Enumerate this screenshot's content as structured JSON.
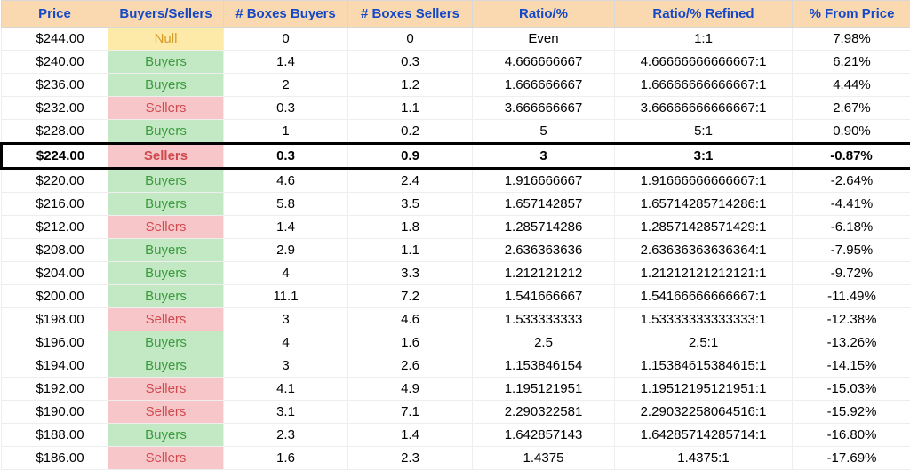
{
  "headers": {
    "price": "Price",
    "buyers_sellers": "Buyers/Sellers",
    "boxes_buyers": "# Boxes Buyers",
    "boxes_sellers": "# Boxes Sellers",
    "ratio": "Ratio/%",
    "ratio_refined": "Ratio/% Refined",
    "from_price": "% From Price"
  },
  "status_classes": {
    "Null": "null-cell",
    "Buyers": "buyers-cell",
    "Sellers": "sellers-cell"
  },
  "rows": [
    {
      "price": "$244.00",
      "bs": "Null",
      "bb": "0",
      "sb": "0",
      "ratio": "Even",
      "refined": "1:1",
      "from": "7.98%",
      "highlight": false
    },
    {
      "price": "$240.00",
      "bs": "Buyers",
      "bb": "1.4",
      "sb": "0.3",
      "ratio": "4.666666667",
      "refined": "4.66666666666667:1",
      "from": "6.21%",
      "highlight": false
    },
    {
      "price": "$236.00",
      "bs": "Buyers",
      "bb": "2",
      "sb": "1.2",
      "ratio": "1.666666667",
      "refined": "1.66666666666667:1",
      "from": "4.44%",
      "highlight": false
    },
    {
      "price": "$232.00",
      "bs": "Sellers",
      "bb": "0.3",
      "sb": "1.1",
      "ratio": "3.666666667",
      "refined": "3.66666666666667:1",
      "from": "2.67%",
      "highlight": false
    },
    {
      "price": "$228.00",
      "bs": "Buyers",
      "bb": "1",
      "sb": "0.2",
      "ratio": "5",
      "refined": "5:1",
      "from": "0.90%",
      "highlight": false
    },
    {
      "price": "$224.00",
      "bs": "Sellers",
      "bb": "0.3",
      "sb": "0.9",
      "ratio": "3",
      "refined": "3:1",
      "from": "-0.87%",
      "highlight": true
    },
    {
      "price": "$220.00",
      "bs": "Buyers",
      "bb": "4.6",
      "sb": "2.4",
      "ratio": "1.916666667",
      "refined": "1.91666666666667:1",
      "from": "-2.64%",
      "highlight": false
    },
    {
      "price": "$216.00",
      "bs": "Buyers",
      "bb": "5.8",
      "sb": "3.5",
      "ratio": "1.657142857",
      "refined": "1.65714285714286:1",
      "from": "-4.41%",
      "highlight": false
    },
    {
      "price": "$212.00",
      "bs": "Sellers",
      "bb": "1.4",
      "sb": "1.8",
      "ratio": "1.285714286",
      "refined": "1.28571428571429:1",
      "from": "-6.18%",
      "highlight": false
    },
    {
      "price": "$208.00",
      "bs": "Buyers",
      "bb": "2.9",
      "sb": "1.1",
      "ratio": "2.636363636",
      "refined": "2.63636363636364:1",
      "from": "-7.95%",
      "highlight": false
    },
    {
      "price": "$204.00",
      "bs": "Buyers",
      "bb": "4",
      "sb": "3.3",
      "ratio": "1.212121212",
      "refined": "1.21212121212121:1",
      "from": "-9.72%",
      "highlight": false
    },
    {
      "price": "$200.00",
      "bs": "Buyers",
      "bb": "11.1",
      "sb": "7.2",
      "ratio": "1.541666667",
      "refined": "1.54166666666667:1",
      "from": "-11.49%",
      "highlight": false
    },
    {
      "price": "$198.00",
      "bs": "Sellers",
      "bb": "3",
      "sb": "4.6",
      "ratio": "1.533333333",
      "refined": "1.53333333333333:1",
      "from": "-12.38%",
      "highlight": false
    },
    {
      "price": "$196.00",
      "bs": "Buyers",
      "bb": "4",
      "sb": "1.6",
      "ratio": "2.5",
      "refined": "2.5:1",
      "from": "-13.26%",
      "highlight": false
    },
    {
      "price": "$194.00",
      "bs": "Buyers",
      "bb": "3",
      "sb": "2.6",
      "ratio": "1.153846154",
      "refined": "1.15384615384615:1",
      "from": "-14.15%",
      "highlight": false
    },
    {
      "price": "$192.00",
      "bs": "Sellers",
      "bb": "4.1",
      "sb": "4.9",
      "ratio": "1.195121951",
      "refined": "1.19512195121951:1",
      "from": "-15.03%",
      "highlight": false
    },
    {
      "price": "$190.00",
      "bs": "Sellers",
      "bb": "3.1",
      "sb": "7.1",
      "ratio": "2.290322581",
      "refined": "2.29032258064516:1",
      "from": "-15.92%",
      "highlight": false
    },
    {
      "price": "$188.00",
      "bs": "Buyers",
      "bb": "2.3",
      "sb": "1.4",
      "ratio": "1.642857143",
      "refined": "1.64285714285714:1",
      "from": "-16.80%",
      "highlight": false
    },
    {
      "price": "$186.00",
      "bs": "Sellers",
      "bb": "1.6",
      "sb": "2.3",
      "ratio": "1.4375",
      "refined": "1.4375:1",
      "from": "-17.69%",
      "highlight": false
    }
  ]
}
